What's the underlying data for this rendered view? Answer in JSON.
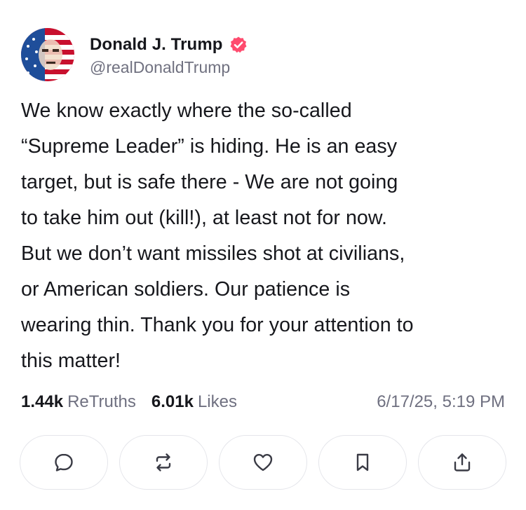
{
  "author": {
    "display_name": "Donald J. Trump",
    "handle": "@realDonaldTrump",
    "verified_color": "#ff4b6e"
  },
  "post": {
    "text": "We know exactly where the so-called\n“Supreme Leader” is hiding. He is an easy\ntarget, but is safe there - We are not going\nto take him out (kill!), at least not for now.\nBut we don’t want missiles shot at civilians,\nor American soldiers. Our patience is\nwearing thin. Thank you for your attention to\nthis matter!"
  },
  "stats": {
    "retruths_count": "1.44k",
    "retruths_label": "ReTruths",
    "likes_count": "6.01k",
    "likes_label": "Likes",
    "timestamp": "6/17/25, 5:19 PM"
  },
  "actions": [
    {
      "icon": "reply-icon"
    },
    {
      "icon": "retruth-icon"
    },
    {
      "icon": "like-heart-icon"
    },
    {
      "icon": "bookmark-icon"
    },
    {
      "icon": "share-icon"
    }
  ],
  "colors": {
    "text": "#16171c",
    "muted": "#707180",
    "button_border": "#e4e5ea"
  }
}
